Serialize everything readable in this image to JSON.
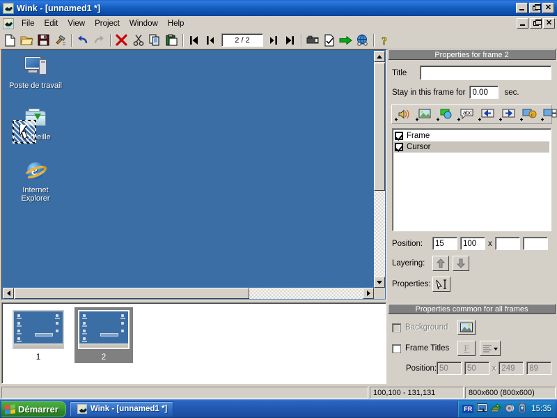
{
  "window": {
    "title": "Wink - [unnamed1 *]",
    "app_icon": "wink-icon",
    "controls": {
      "minimize": "minimize-icon",
      "restore": "restore-icon",
      "close": "close-icon"
    }
  },
  "menu": {
    "items": [
      {
        "label": "File"
      },
      {
        "label": "Edit"
      },
      {
        "label": "View"
      },
      {
        "label": "Project"
      },
      {
        "label": "Window"
      },
      {
        "label": "Help"
      }
    ]
  },
  "toolbar": {
    "buttons": [
      {
        "name": "new-project-icon"
      },
      {
        "name": "open-project-icon"
      },
      {
        "name": "save-project-icon"
      },
      {
        "name": "build-hammer-icon"
      },
      {
        "name": "undo-icon"
      },
      {
        "name": "redo-icon"
      },
      {
        "name": "delete-frame-icon"
      },
      {
        "name": "cut-icon"
      },
      {
        "name": "copy-icon"
      },
      {
        "name": "paste-icon"
      },
      {
        "name": "first-frame-icon"
      },
      {
        "name": "previous-frame-icon"
      },
      {
        "name": "next-frame-icon"
      },
      {
        "name": "last-frame-icon"
      },
      {
        "name": "render-film-icon"
      },
      {
        "name": "render-document-icon"
      },
      {
        "name": "export-arrow-icon"
      },
      {
        "name": "browse-globe-icon"
      },
      {
        "name": "help-icon"
      }
    ],
    "frame_counter": "2 / 2"
  },
  "canvas": {
    "desktop_icons": [
      {
        "name": "poste-de-travail",
        "label": "Poste de travail",
        "icon": "my-computer-icon"
      },
      {
        "name": "corbeille",
        "label": "Corbeille",
        "icon": "folder-icon"
      },
      {
        "name": "internet-explorer",
        "label": "Internet\nExplorer",
        "label_line1": "Internet",
        "label_line2": "Explorer",
        "icon": "internet-explorer-icon"
      }
    ],
    "selected_object": "cursor-object"
  },
  "thumbnails": {
    "frames": [
      {
        "number": "1",
        "selected": false
      },
      {
        "number": "2",
        "selected": true
      }
    ]
  },
  "frame_properties": {
    "header": "Properties for frame 2",
    "title_label": "Title",
    "title_value": "",
    "title_placeholder": "",
    "stay_label": "Stay in this frame for",
    "stay_value": "0.00",
    "stay_unit": "sec.",
    "add_buttons": [
      {
        "name": "add-sound-icon"
      },
      {
        "name": "add-image-icon"
      },
      {
        "name": "add-shape-icon"
      },
      {
        "name": "add-textbox-icon"
      },
      {
        "name": "add-previous-button-icon"
      },
      {
        "name": "add-next-button-icon"
      },
      {
        "name": "add-browser-link-icon"
      },
      {
        "name": "add-custom-button-icon"
      }
    ],
    "objects": [
      {
        "label": "Frame",
        "checked": true,
        "selected": false
      },
      {
        "label": "Cursor",
        "checked": true,
        "selected": true
      }
    ],
    "position_label": "Position:",
    "position_x": "15",
    "position_y": "100",
    "position_separator": "x",
    "position_w": "",
    "position_h": "",
    "layering_label": "Layering:",
    "layering_up": "move-up-icon",
    "layering_down": "move-down-icon",
    "properties_label": "Properties:",
    "properties_button": "cursor-properties-icon"
  },
  "common_properties": {
    "header": "Properties common for all frames",
    "background_label": "Background",
    "background_checked": false,
    "background_button": "background-image-icon",
    "frame_titles_label": "Frame Titles",
    "frame_titles_checked": false,
    "font_button": "font-icon",
    "align_button": "text-align-icon",
    "position_label": "Position:",
    "position_x": "50",
    "position_y": "50",
    "position_separator": "x",
    "position_w": "249",
    "position_h": "89"
  },
  "statusbar": {
    "coordinates": "100,100 - 131,131",
    "dimensions": "800x600 (800x600)"
  },
  "taskbar": {
    "start_label": "Démarrer",
    "start_icon": "windows-flag-icon",
    "tasks": [
      {
        "label": "Wink - [unnamed1 *]",
        "icon": "wink-icon"
      }
    ],
    "tray": {
      "language": "FR",
      "icons": [
        {
          "name": "display-settings-icon"
        },
        {
          "name": "antivirus-icon"
        },
        {
          "name": "volume-icon"
        },
        {
          "name": "battery-icon"
        }
      ],
      "clock": "15:35"
    }
  },
  "colors": {
    "titlebar_blue": "#1e66c8",
    "desktop_blue": "#3b6ea5",
    "face": "#d4d0c8",
    "panel_header": "#808080",
    "selection": "#c8c4bc"
  }
}
